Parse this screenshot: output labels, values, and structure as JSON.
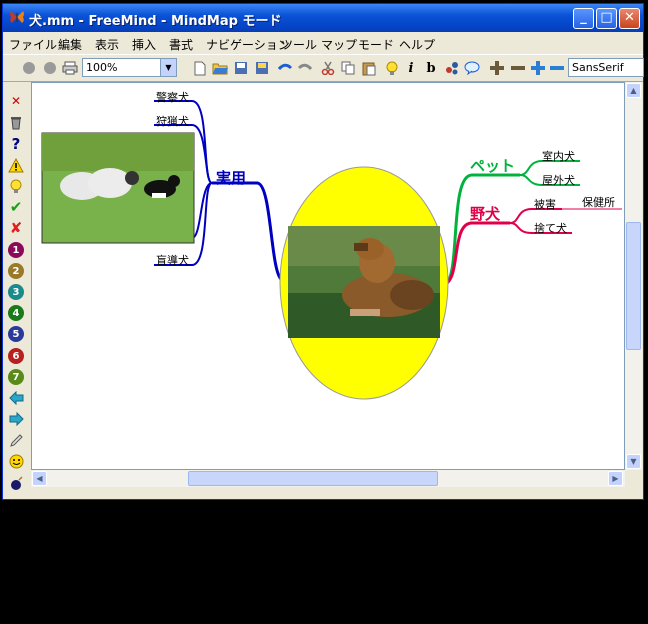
{
  "window": {
    "title": "犬.mm - FreeMind - MindMap モード",
    "minimize": "_",
    "maximize": "□",
    "close": "✕"
  },
  "menu": [
    "ファイル",
    "編集",
    "表示",
    "挿入",
    "書式",
    "ナビゲーション",
    "ツール",
    "マップ",
    "モード",
    "ヘルプ"
  ],
  "toolbar": {
    "zoom": "100%",
    "font": "SansSerif"
  },
  "left_tools": [
    "✕",
    "trash",
    "?",
    "!",
    "bulb",
    "✔",
    "✘",
    "1",
    "2",
    "3",
    "4",
    "5",
    "6",
    "7",
    "←",
    "→",
    "pencil",
    "smile",
    "bomb"
  ],
  "mindmap": {
    "left_branch": {
      "label": "実用",
      "color": "#0000c0",
      "children": [
        "警察犬",
        "狩猟犬",
        "盲導犬"
      ]
    },
    "right_branches": [
      {
        "label": "ペット",
        "color": "#00b33c",
        "children": [
          "室内犬",
          "屋外犬"
        ]
      },
      {
        "label": "野犬",
        "color": "#e0004a",
        "children": [
          "被害",
          "捨て犬"
        ],
        "grandchild": "保健所"
      }
    ],
    "root_fill": "#ffff00"
  }
}
